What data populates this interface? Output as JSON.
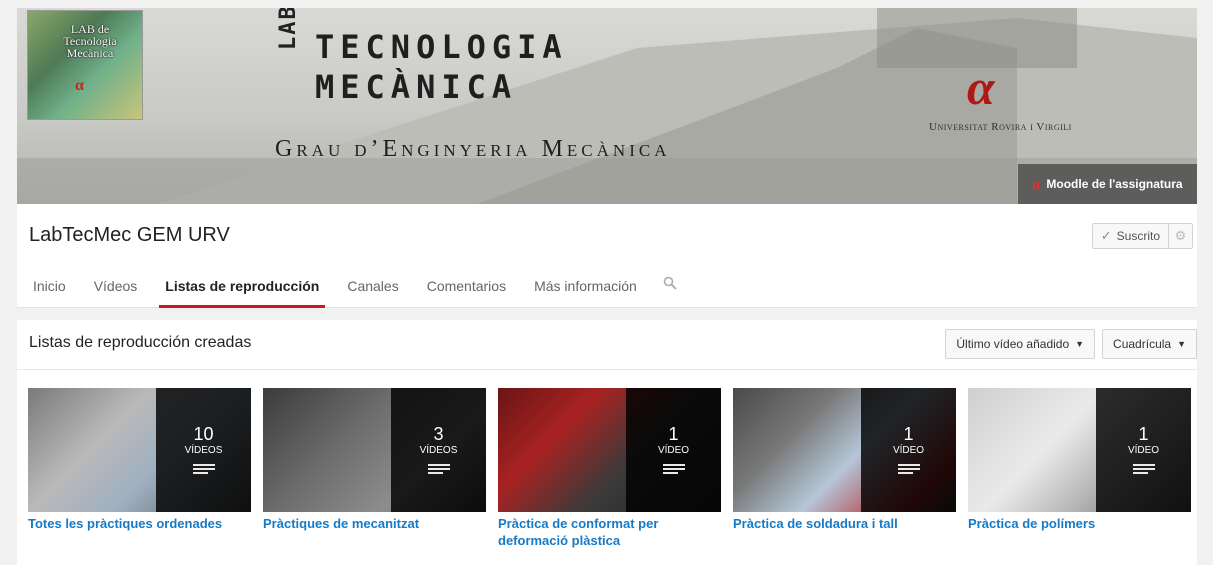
{
  "banner": {
    "logo_text": "LAB de Tecnologia Mecànica",
    "lab_letters": "LAB",
    "title_line1": "TECNOLOGIA",
    "title_line2": "MECÀNICA",
    "subtitle": "Grau d’Enginyeria Mecànica",
    "university": "Universitat Rovira i Virgili",
    "moodle_link": "Moodle de l'assignatura"
  },
  "header": {
    "channel_name": "LabTecMec GEM URV",
    "subscribe_label": "Suscrito"
  },
  "tabs": [
    {
      "label": "Inicio",
      "active": false
    },
    {
      "label": "Vídeos",
      "active": false
    },
    {
      "label": "Listas de reproducción",
      "active": true
    },
    {
      "label": "Canales",
      "active": false
    },
    {
      "label": "Comentarios",
      "active": false
    },
    {
      "label": "Más información",
      "active": false
    }
  ],
  "section": {
    "title": "Listas de reproducción creadas",
    "sort_label": "Último vídeo añadido",
    "view_label": "Cuadrícula"
  },
  "playlists": [
    {
      "count": "10",
      "unit": "VÍDEOS",
      "title": "Totes les pràctiques ordenades"
    },
    {
      "count": "3",
      "unit": "VÍDEOS",
      "title": "Pràctiques de mecanitzat"
    },
    {
      "count": "1",
      "unit": "VÍDEO",
      "title": "Pràctica de conformat per deformació plàstica"
    },
    {
      "count": "1",
      "unit": "VÍDEO",
      "title": "Pràctica de soldadura i tall"
    },
    {
      "count": "1",
      "unit": "VÍDEO",
      "title": "Pràctica de polímers"
    }
  ],
  "colors": {
    "accent": "#cc181e",
    "link": "#167ac6"
  }
}
